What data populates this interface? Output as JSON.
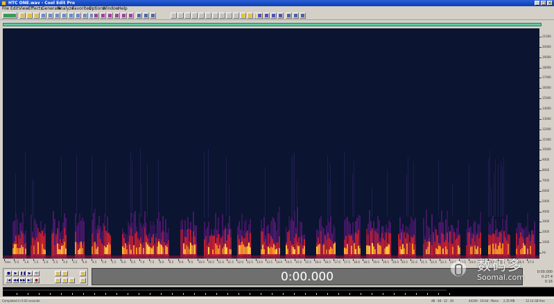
{
  "window": {
    "title": "HTC ONE.wav - Cool Edit Pro",
    "minimize": "_",
    "maximize": "□",
    "close": "×"
  },
  "menu": [
    "File",
    "Edit",
    "View",
    "Effects",
    "Generate",
    "Analyze",
    "Favorites",
    "Options",
    "Window",
    "Help"
  ],
  "toolbar_groups": [
    "mode-toggle",
    "file-tools",
    "edit-tools",
    "view-tools",
    "spectral-tools",
    "analysis-tools",
    "option-tools"
  ],
  "colors": {
    "spectrogram_background": "#0b1430",
    "overview_bar": "#5fc8a0",
    "time_display_bg": "#6f6f6f",
    "titlebar": "#0a3db5"
  },
  "transport": {
    "row1": [
      "■",
      "▶",
      "❚❚",
      "▶",
      "⟲"
    ],
    "row2": [
      "|◀",
      "◀◀",
      "▶▶",
      "▶|",
      "●"
    ]
  },
  "time_display": "0:00.000",
  "selection_panel": {
    "begin": "0:00.000",
    "end": "0:27.4",
    "length": "0:16"
  },
  "frequency_labels": [
    "21000",
    "20000",
    "19000",
    "18000",
    "17000",
    "16000",
    "15000",
    "14000",
    "13000",
    "12000",
    "11000",
    "10000",
    "9000",
    "8000",
    "7000",
    "6000",
    "5000",
    "4000",
    "3000",
    "2000",
    "1000",
    "Hz"
  ],
  "time_labels": [
    "hms",
    "0.5",
    "1.0",
    "1.5",
    "2.0",
    "2.5",
    "3.0",
    "3.5",
    "4.0",
    "4.5",
    "5.0",
    "5.5",
    "6.0",
    "6.5",
    "7.0",
    "7.5",
    "8.0",
    "8.5",
    "9.0",
    "9.5",
    "10.0",
    "10.5",
    "11.0",
    "11.5",
    "12.0",
    "12.5",
    "13.0",
    "13.5",
    "14.0",
    "14.5",
    "15.0",
    "15.5",
    "16.0",
    "16.5",
    "17.0",
    "17.5",
    "18.0",
    "18.5",
    "19.0",
    "19.5",
    "20.0",
    "20.5",
    "21.0",
    "21.5",
    "22.0",
    "22.5",
    "23.0",
    "23.5",
    "24.0",
    "24.5",
    "25.0",
    "25.5",
    "26.0",
    "26.5",
    "27.0"
  ],
  "status": {
    "left": "Completed in 0.02 seconds",
    "rate": "44100 · 16-bit · Mono",
    "size": "2.35 MB",
    "free": "12.14 GB free",
    "level": "dB · 48 · 12 · 30"
  },
  "watermark": {
    "cn": "数码多",
    "en": "Soomal.com"
  }
}
